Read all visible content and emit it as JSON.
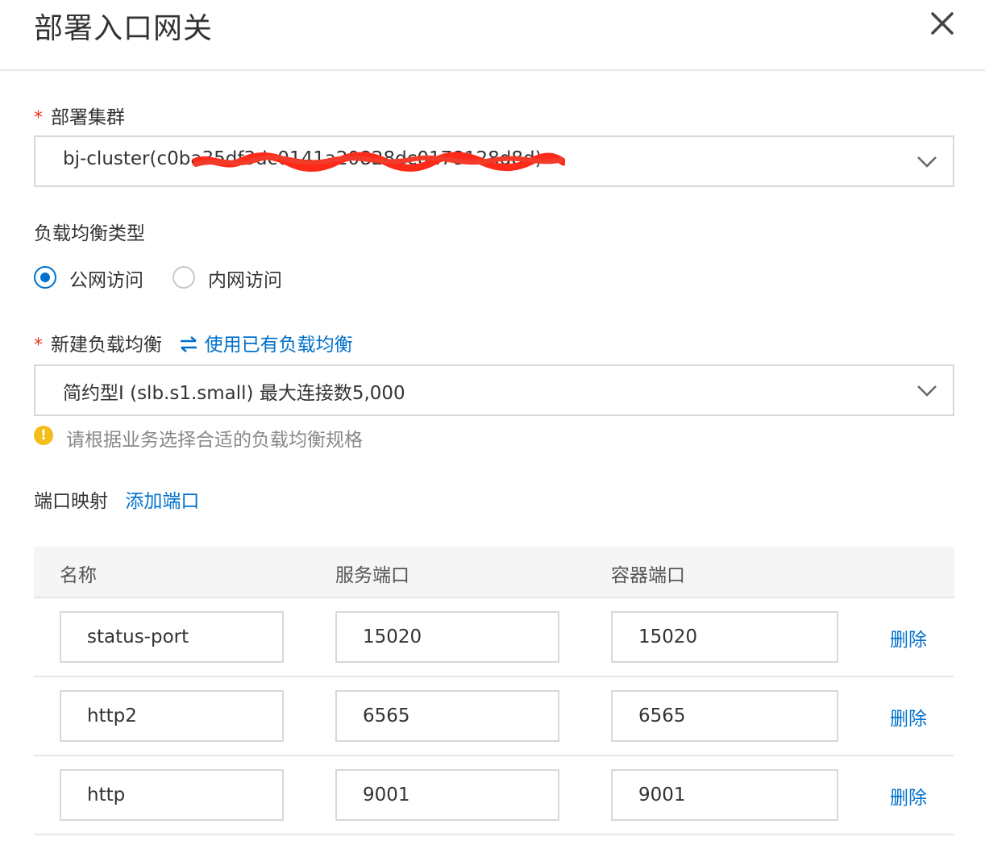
{
  "dialog": {
    "title": "部署入口网关"
  },
  "cluster": {
    "required_mark": "*",
    "label": "部署集群",
    "value": "bj-cluster(c0ba35df3dc0141a20828dc0178128d8d)"
  },
  "lb_type": {
    "label": "负载均衡类型",
    "options": [
      {
        "label": "公网访问",
        "checked": true
      },
      {
        "label": "内网访问",
        "checked": false
      }
    ]
  },
  "new_lb": {
    "required_mark": "*",
    "label": "新建负载均衡",
    "switch_link": "使用已有负载均衡",
    "spec_value": "简约型I (slb.s1.small) 最大连接数5,000",
    "hint": "请根据业务选择合适的负载均衡规格"
  },
  "port_mapping": {
    "label": "端口映射",
    "add_link": "添加端口",
    "columns": [
      "名称",
      "服务端口",
      "容器端口"
    ],
    "rows": [
      {
        "name": "status-port",
        "service_port": "15020",
        "container_port": "15020",
        "action": "删除"
      },
      {
        "name": "http2",
        "service_port": "6565",
        "container_port": "6565",
        "action": "删除"
      },
      {
        "name": "http",
        "service_port": "9001",
        "container_port": "9001",
        "action": "删除"
      }
    ]
  },
  "colors": {
    "accent": "#0070cc",
    "required": "#e8331c",
    "warning": "#f5bd1a",
    "redaction": "#ff2a1a"
  }
}
